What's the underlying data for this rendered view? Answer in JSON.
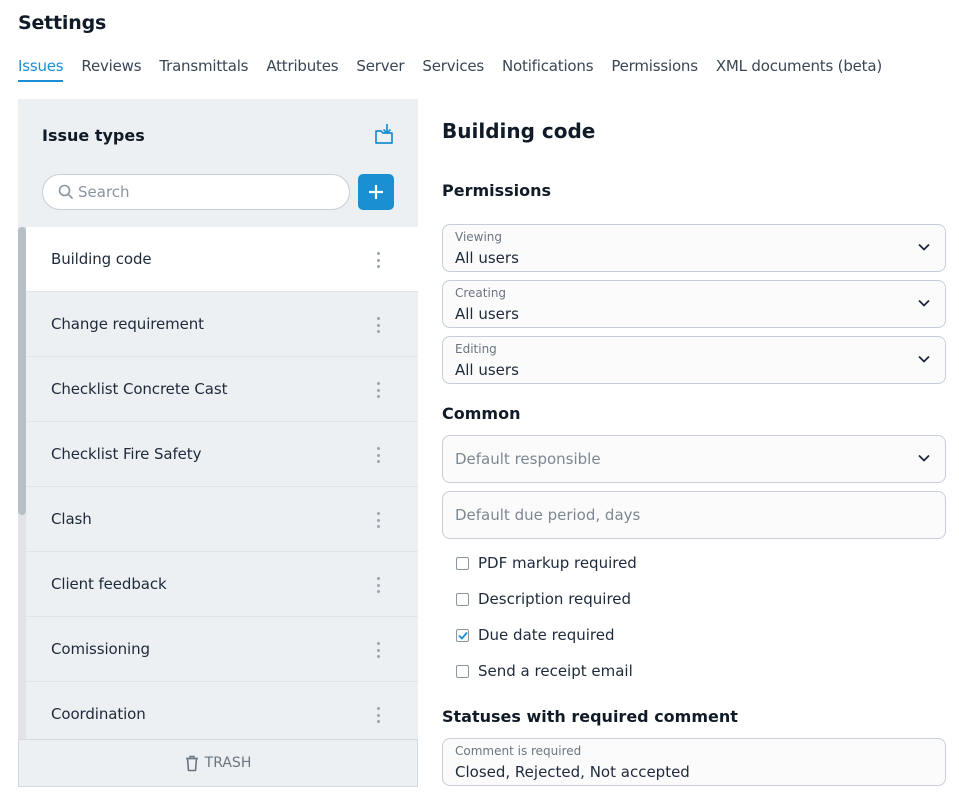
{
  "page": {
    "title": "Settings"
  },
  "tabs": [
    {
      "label": "Issues",
      "active": true
    },
    {
      "label": "Reviews"
    },
    {
      "label": "Transmittals"
    },
    {
      "label": "Attributes"
    },
    {
      "label": "Server"
    },
    {
      "label": "Services"
    },
    {
      "label": "Notifications"
    },
    {
      "label": "Permissions"
    },
    {
      "label": "XML documents (beta)"
    }
  ],
  "issue_types": {
    "title": "Issue types",
    "import_icon": "folder-import-icon",
    "search": {
      "placeholder": "Search",
      "value": ""
    },
    "add_icon": "plus-icon",
    "items": [
      {
        "label": "Building code",
        "selected": true
      },
      {
        "label": "Change requirement"
      },
      {
        "label": "Checklist Concrete Cast"
      },
      {
        "label": "Checklist Fire Safety"
      },
      {
        "label": "Clash"
      },
      {
        "label": "Client feedback"
      },
      {
        "label": "Comissioning"
      },
      {
        "label": "Coordination"
      }
    ],
    "trash_label": "TRASH"
  },
  "detail": {
    "title": "Building code",
    "permissions": {
      "heading": "Permissions",
      "viewing": {
        "label": "Viewing",
        "value": "All users"
      },
      "creating": {
        "label": "Creating",
        "value": "All users"
      },
      "editing": {
        "label": "Editing",
        "value": "All users"
      }
    },
    "common": {
      "heading": "Common",
      "default_responsible": {
        "placeholder": "Default responsible"
      },
      "default_due_period": {
        "placeholder": "Default due period, days"
      },
      "checkboxes": [
        {
          "label": "PDF markup required",
          "checked": false
        },
        {
          "label": "Description required",
          "checked": false
        },
        {
          "label": "Due date required",
          "checked": true
        },
        {
          "label": "Send a receipt email",
          "checked": false
        }
      ]
    },
    "statuses": {
      "heading": "Statuses with required comment",
      "field": {
        "label": "Comment is required",
        "value": "Closed, Rejected, Not accepted"
      }
    }
  },
  "colors": {
    "accent": "#1a8fd1",
    "panel_bg": "#edf0f3",
    "text": "#1e2a3a"
  }
}
